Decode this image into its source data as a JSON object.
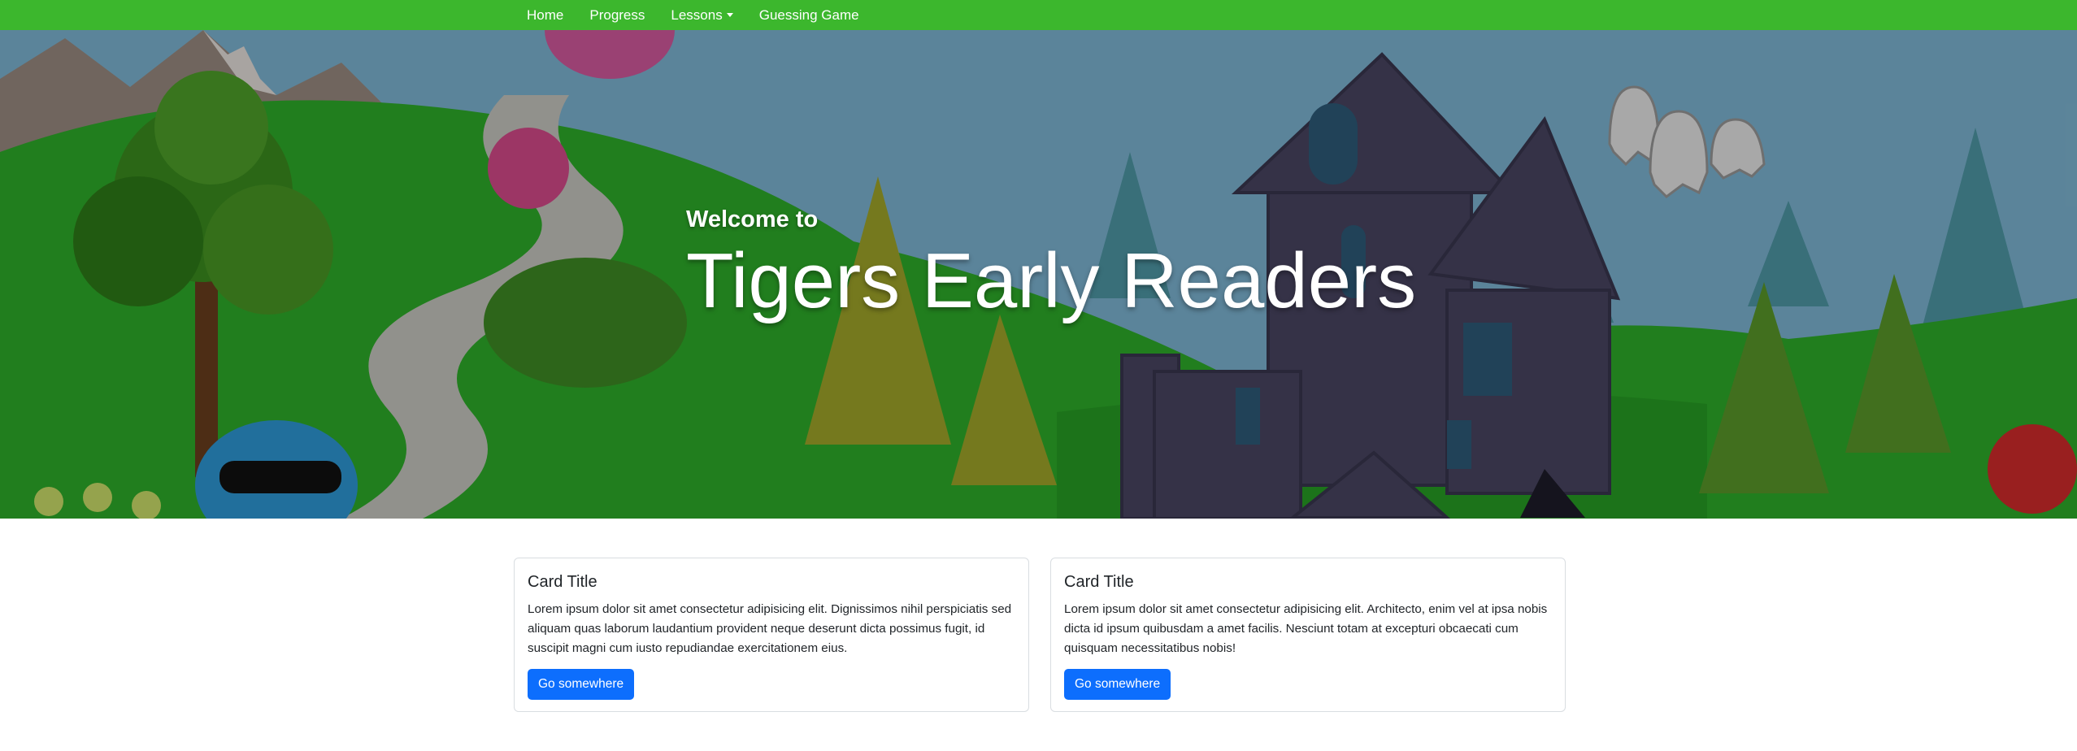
{
  "nav": {
    "items": [
      {
        "label": "Home"
      },
      {
        "label": "Progress"
      },
      {
        "label": "Lessons",
        "dropdown": true
      },
      {
        "label": "Guessing Game"
      }
    ],
    "color": "#3cb72d"
  },
  "hero": {
    "subtitle": "Welcome to",
    "title": "Tigers Early Readers",
    "background": "cartoon landscape with trees, haunted house, ghosts and monsters"
  },
  "cards": [
    {
      "title": "Card Title",
      "text": "Lorem ipsum dolor sit amet consectetur adipisicing elit. Dignissimos nihil perspiciatis sed aliquam quas laborum laudantium provident neque deserunt dicta possimus fugit, id suscipit magni cum iusto repudiandae exercitationem eius.",
      "button": "Go somewhere"
    },
    {
      "title": "Card Title",
      "text": "Lorem ipsum dolor sit amet consectetur adipisicing elit. Architecto, enim vel at ipsa nobis dicta id ipsum quibusdam a amet facilis. Nesciunt totam at excepturi obcaecati cum quisquam necessitatibus nobis!",
      "button": "Go somewhere"
    }
  ],
  "colors": {
    "button": "#0d6efd",
    "navbar": "#3cb72d"
  }
}
